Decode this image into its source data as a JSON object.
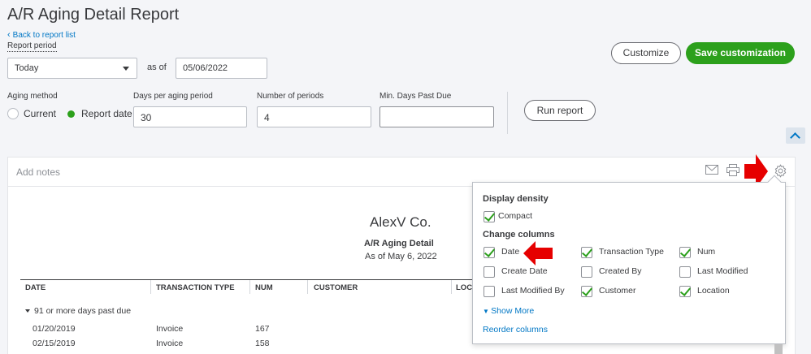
{
  "page": {
    "title": "A/R Aging Detail Report",
    "back_link": "Back to report list"
  },
  "filters": {
    "report_period_label": "Report period",
    "period_value": "Today",
    "as_of_label": "as of",
    "as_of_date": "05/06/2022",
    "aging_method_label": "Aging method",
    "aging_current": "Current",
    "aging_report_date": "Report date",
    "days_per_period_label": "Days per aging period",
    "days_per_period": "30",
    "num_periods_label": "Number of periods",
    "num_periods": "4",
    "min_days_label": "Min. Days Past Due",
    "min_days": ""
  },
  "buttons": {
    "customize": "Customize",
    "save_customization": "Save customization",
    "run_report": "Run report"
  },
  "report": {
    "add_notes": "Add notes",
    "company": "AlexV Co.",
    "title": "A/R Aging Detail",
    "subtitle": "As of May 6, 2022",
    "columns": [
      "DATE",
      "TRANSACTION TYPE",
      "NUM",
      "CUSTOMER",
      "LOCA"
    ],
    "group": "91 or more days past due",
    "rows": [
      {
        "date": "01/20/2019",
        "type": "Invoice",
        "num": "167"
      },
      {
        "date": "02/15/2019",
        "type": "Invoice",
        "num": "158"
      }
    ]
  },
  "settings_popup": {
    "display_density": "Display density",
    "compact": "Compact",
    "change_columns": "Change columns",
    "columns": [
      {
        "label": "Date",
        "checked": true
      },
      {
        "label": "Transaction Type",
        "checked": true
      },
      {
        "label": "Num",
        "checked": true
      },
      {
        "label": "Create Date",
        "checked": false
      },
      {
        "label": "Created By",
        "checked": false
      },
      {
        "label": "Last Modified",
        "checked": false
      },
      {
        "label": "Last Modified By",
        "checked": false
      },
      {
        "label": "Customer",
        "checked": true
      },
      {
        "label": "Location",
        "checked": true
      }
    ],
    "show_more": "Show More",
    "reorder_columns": "Reorder columns"
  },
  "colors": {
    "accent_green": "#2ca01c",
    "link_blue": "#0077c5",
    "annotation_red": "#e60000"
  },
  "icons": [
    "chevron-left-icon",
    "caret-down-icon",
    "chevron-up-icon",
    "email-icon",
    "print-icon",
    "gear-icon",
    "red-arrow-icon"
  ]
}
